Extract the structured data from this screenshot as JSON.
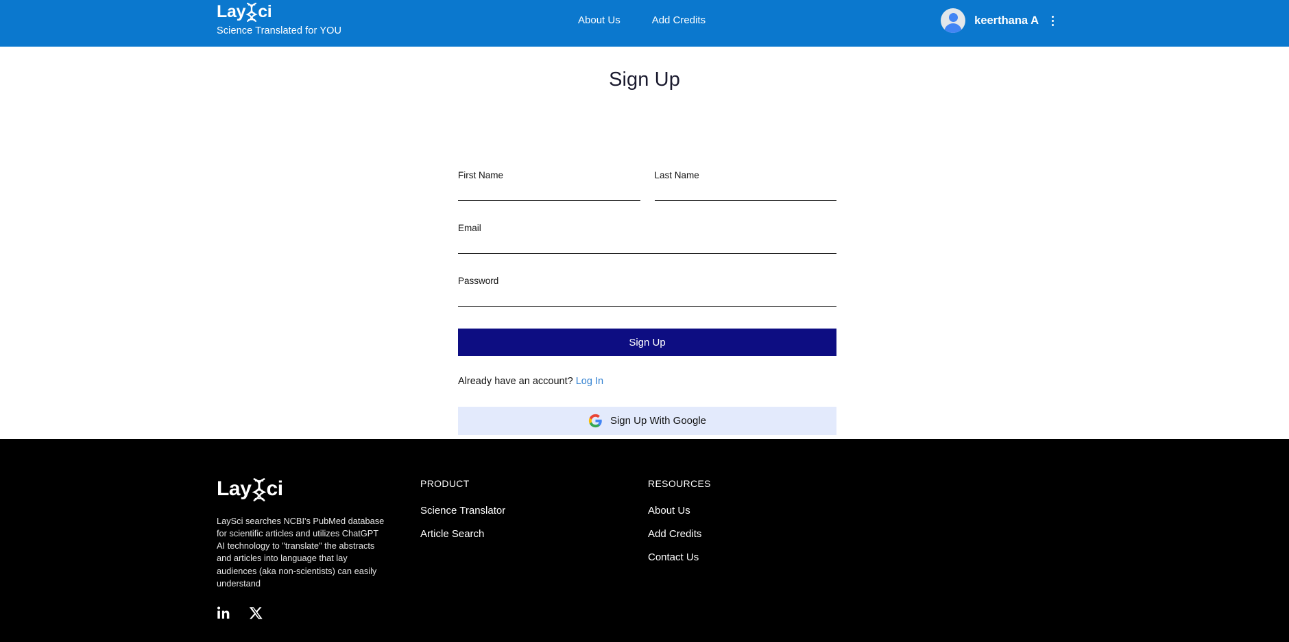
{
  "header": {
    "logo": {
      "part1": "Lay",
      "helix_icon": "dna-helix-icon",
      "part2": "ci"
    },
    "tagline": "Science Translated for YOU",
    "nav": [
      {
        "label": "About Us",
        "name": "nav-about-us"
      },
      {
        "label": "Add Credits",
        "name": "nav-add-credits"
      }
    ],
    "user": {
      "name": "keerthana A",
      "avatar_icon": "user-avatar-icon",
      "menu_icon": "kebab-menu-icon"
    },
    "background_color": "#0b78ce"
  },
  "main": {
    "title": "Sign Up",
    "fields": {
      "first_name": {
        "label": "First Name",
        "value": "",
        "placeholder": ""
      },
      "last_name": {
        "label": "Last Name",
        "value": "",
        "placeholder": ""
      },
      "email": {
        "label": "Email",
        "value": "",
        "placeholder": ""
      },
      "password": {
        "label": "Password",
        "value": "",
        "placeholder": ""
      }
    },
    "submit_label": "Sign Up",
    "submit_color": "#0d0d82",
    "alt_prompt": "Already have an account?",
    "alt_link": "Log In",
    "alt_link_color": "#2f7fd0",
    "google_label": "Sign Up With Google",
    "google_icon": "google-g-icon",
    "google_bg": "#e3eafc"
  },
  "footer": {
    "logo": {
      "part1": "Lay",
      "helix_icon": "dna-helix-icon",
      "part2": "ci"
    },
    "description": "LaySci searches NCBI's PubMed database for scientific articles and utilizes ChatGPT AI technology to \"translate\" the abstracts and articles into language that lay audiences (aka non-scientists) can easily understand",
    "socials": [
      {
        "name": "linkedin-icon",
        "label": "in"
      },
      {
        "name": "x-twitter-icon",
        "label": "X"
      }
    ],
    "columns": [
      {
        "heading": "PRODUCT",
        "links": [
          {
            "label": "Science Translator",
            "name": "footer-link-science-translator"
          },
          {
            "label": "Article Search",
            "name": "footer-link-article-search"
          }
        ]
      },
      {
        "heading": "RESOURCES",
        "links": [
          {
            "label": "About Us",
            "name": "footer-link-about-us"
          },
          {
            "label": "Add Credits",
            "name": "footer-link-add-credits"
          },
          {
            "label": "Contact Us",
            "name": "footer-link-contact-us"
          }
        ]
      }
    ],
    "background_color": "#000000"
  }
}
